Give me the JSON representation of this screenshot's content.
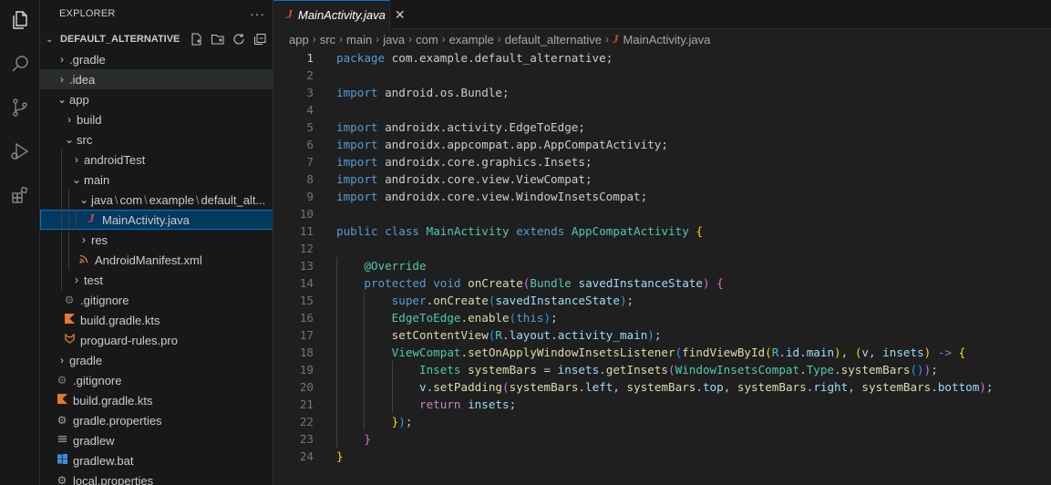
{
  "explorer": {
    "title": "EXPLORER",
    "more": "···",
    "project": "DEFAULT_ALTERNATIVE",
    "tree": [
      {
        "label": ".gradle"
      },
      {
        "label": ".idea"
      },
      {
        "label": "app"
      },
      {
        "label": "build"
      },
      {
        "label": "src"
      },
      {
        "label": "androidTest"
      },
      {
        "label": "main"
      },
      {
        "path": [
          "java",
          "com",
          "example",
          "default_alt..."
        ]
      },
      {
        "label": "MainActivity.java"
      },
      {
        "label": "res"
      },
      {
        "label": "AndroidManifest.xml"
      },
      {
        "label": "test"
      },
      {
        "label": ".gitignore"
      },
      {
        "label": "build.gradle.kts"
      },
      {
        "label": "proguard-rules.pro"
      },
      {
        "label": "gradle"
      },
      {
        "label": ".gitignore"
      },
      {
        "label": "build.gradle.kts"
      },
      {
        "label": "gradle.properties"
      },
      {
        "label": "gradlew"
      },
      {
        "label": "gradlew.bat"
      },
      {
        "label": "local.properties"
      }
    ]
  },
  "tab": {
    "icon": "J",
    "label": "MainActivity.java",
    "close": "✕"
  },
  "breadcrumb": {
    "parts": [
      "app",
      "src",
      "main",
      "java",
      "com",
      "example",
      "default_alternative"
    ],
    "file_icon": "J",
    "file": "MainActivity.java"
  },
  "editor": {
    "line_numbers": [
      "1",
      "2",
      "3",
      "4",
      "5",
      "6",
      "7",
      "8",
      "9",
      "10",
      "11",
      "12",
      "13",
      "14",
      "15",
      "16",
      "17",
      "18",
      "19",
      "20",
      "21",
      "22",
      "23",
      "24"
    ],
    "active_line": "1",
    "lines": [
      "package com.example.default_alternative;",
      "",
      "import android.os.Bundle;",
      "",
      "import androidx.activity.EdgeToEdge;",
      "import androidx.appcompat.app.AppCompatActivity;",
      "import androidx.core.graphics.Insets;",
      "import androidx.core.view.ViewCompat;",
      "import androidx.core.view.WindowInsetsCompat;",
      "",
      "public class MainActivity extends AppCompatActivity {",
      "",
      "    @Override",
      "    protected void onCreate(Bundle savedInstanceState) {",
      "        super.onCreate(savedInstanceState);",
      "        EdgeToEdge.enable(this);",
      "        setContentView(R.layout.activity_main);",
      "        ViewCompat.setOnApplyWindowInsetsListener(findViewById(R.id.main), (v, insets) -> {",
      "            Insets systemBars = insets.getInsets(WindowInsetsCompat.Type.systemBars());",
      "            v.setPadding(systemBars.left, systemBars.top, systemBars.right, systemBars.bottom);",
      "            return insets;",
      "        });",
      "    }",
      "}"
    ]
  },
  "colors": {
    "accent": "#0078d4",
    "keyword": "#569cd6",
    "control": "#c586c0",
    "type": "#4ec9b0",
    "function": "#dcdcaa",
    "variable": "#9cdcfe",
    "java_icon": "#e0443c"
  }
}
